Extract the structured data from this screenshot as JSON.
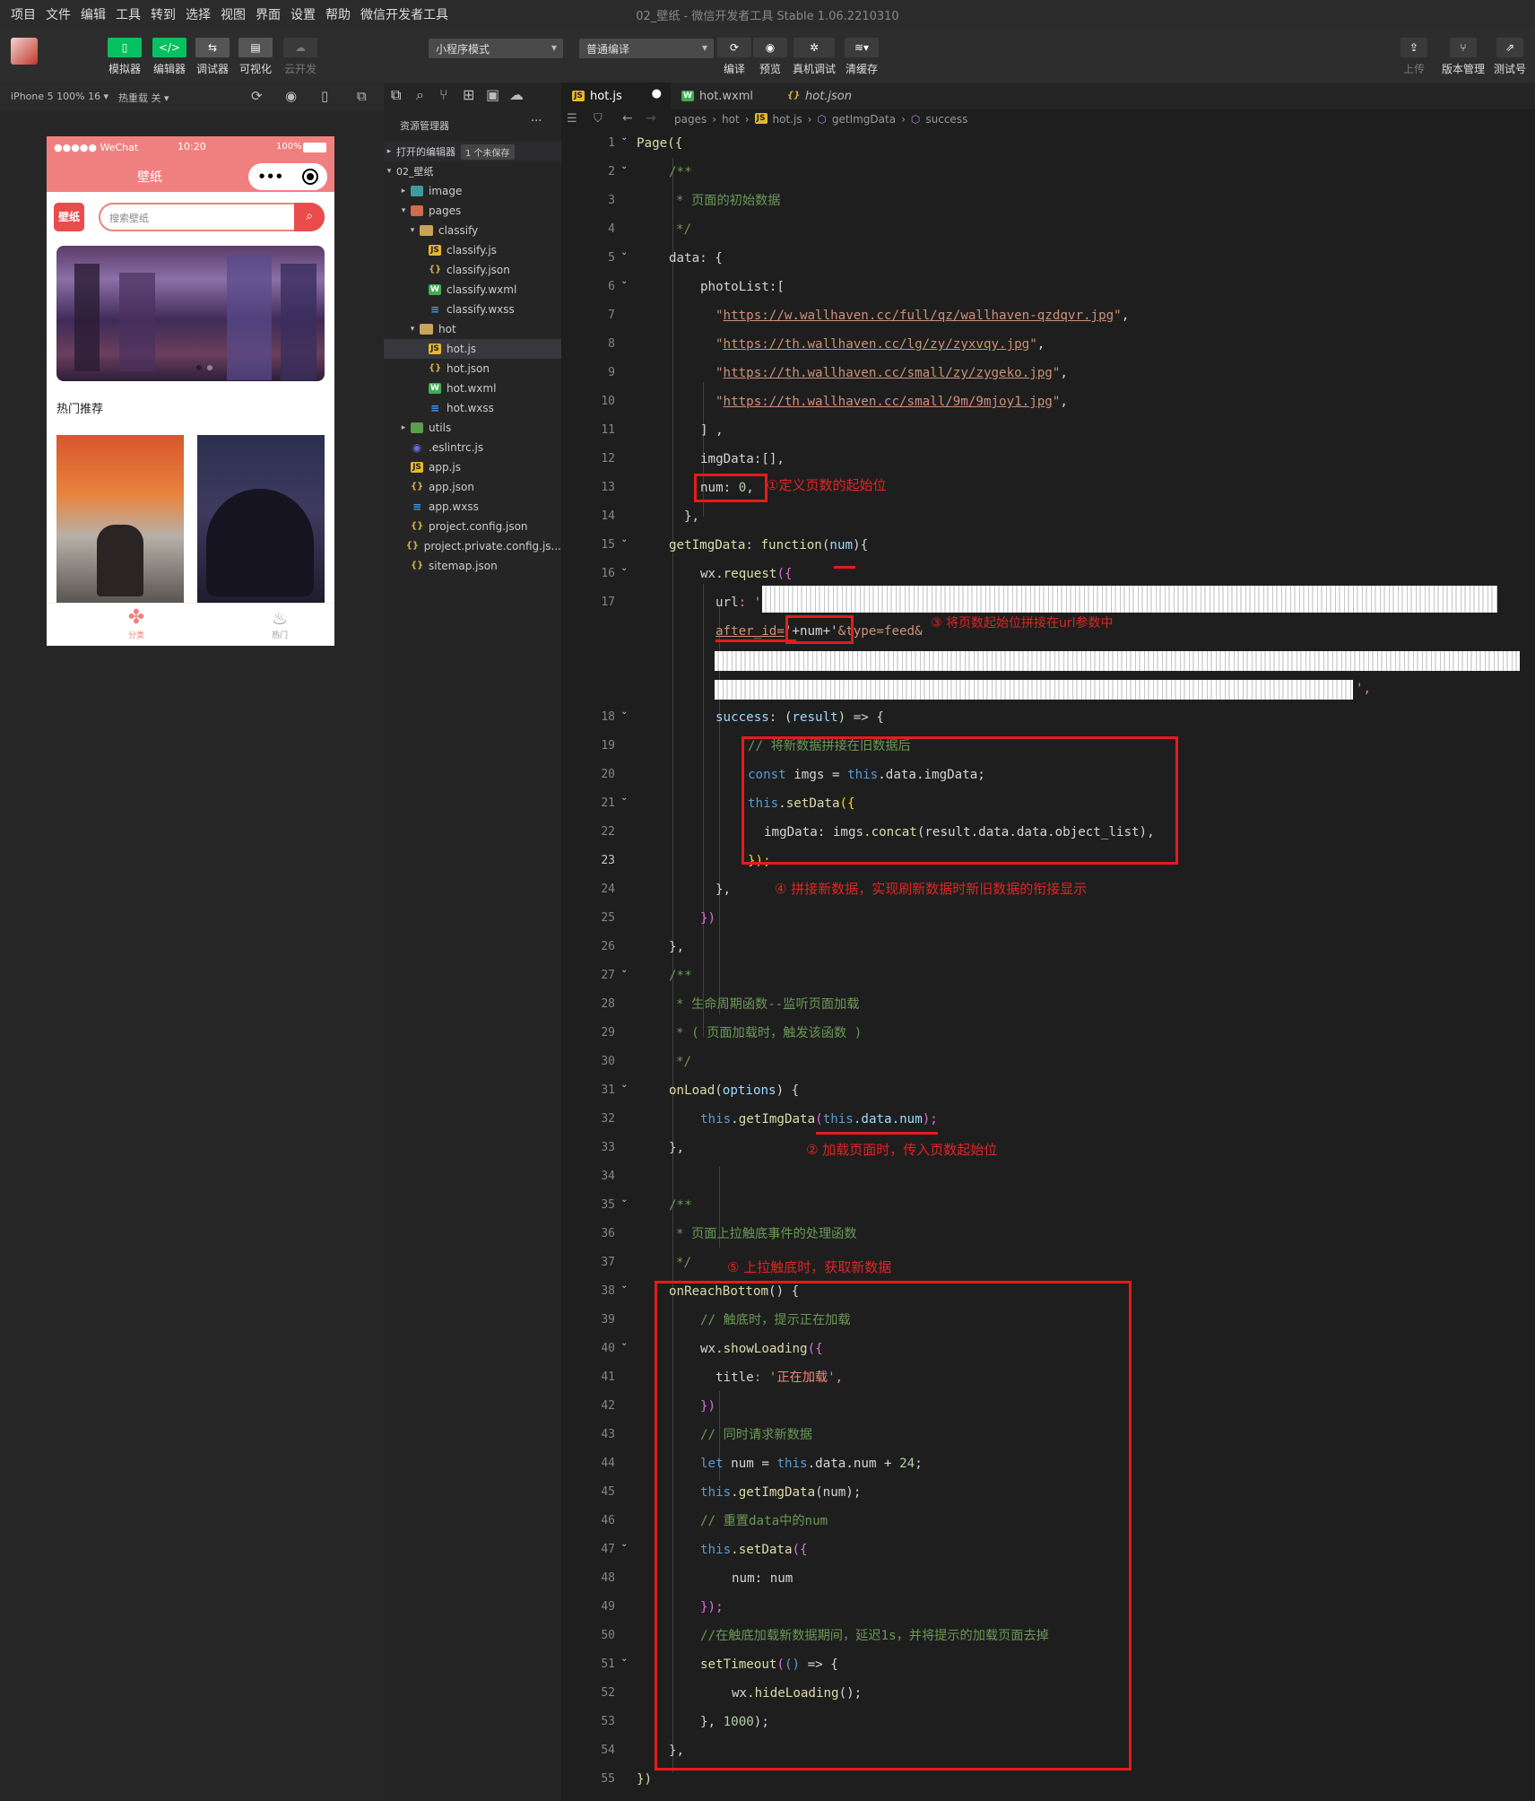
{
  "menubar": {
    "items": [
      "项目",
      "文件",
      "编辑",
      "工具",
      "转到",
      "选择",
      "视图",
      "界面",
      "设置",
      "帮助",
      "微信开发者工具"
    ],
    "window_title": "02_壁纸 - 微信开发者工具 Stable 1.06.2210310"
  },
  "toolbar": {
    "left_buttons": [
      {
        "label": "模拟器",
        "icon": "phone-icon",
        "color": "#07c160"
      },
      {
        "label": "编辑器",
        "icon": "code-icon",
        "color": "#07c160"
      },
      {
        "label": "调试器",
        "icon": "debug-icon",
        "color": "#555555"
      },
      {
        "label": "可视化",
        "icon": "layout-icon",
        "color": "#555555"
      },
      {
        "label": "云开发",
        "icon": "cloud-icon",
        "color": "#3a3a3a"
      }
    ],
    "mode_select": "小程序模式",
    "compile_select": "普通编译",
    "mid_buttons": [
      {
        "label": "编译",
        "icon": "refresh-icon"
      },
      {
        "label": "预览",
        "icon": "eye-icon"
      },
      {
        "label": "真机调试",
        "icon": "bug-icon"
      },
      {
        "label": "清缓存",
        "icon": "layers-icon"
      }
    ],
    "right_buttons": [
      {
        "label": "上传",
        "icon": "upload-icon"
      },
      {
        "label": "版本管理",
        "icon": "branch-icon"
      },
      {
        "label": "测试号",
        "icon": "external-icon"
      }
    ]
  },
  "simulator": {
    "device": "iPhone 5 100% 16 ▾",
    "hot_reload": "热重载 关 ▾",
    "status_left": "●●●●● WeChat",
    "status_time": "10:20",
    "status_right": "100%",
    "nav_title": "壁纸",
    "logo_text": "壁纸",
    "search_placeholder": "搜索壁纸",
    "section_title": "热门推荐",
    "tabbar": [
      {
        "label": "分类",
        "icon": "clover-icon"
      },
      {
        "label": "热门",
        "icon": "fire-icon"
      }
    ]
  },
  "explorer": {
    "title": "资源管理器",
    "more": "···",
    "open_editors": "打开的编辑器",
    "unsaved_badge": "1 个未保存",
    "project": "02_壁纸",
    "tree": [
      {
        "label": "image",
        "type": "fimg",
        "depth": 1,
        "arrow": "▸"
      },
      {
        "label": "pages",
        "type": "fpages",
        "depth": 1,
        "arrow": "▾"
      },
      {
        "label": "classify",
        "type": "folder",
        "depth": 2,
        "arrow": "▾"
      },
      {
        "label": "classify.js",
        "type": "js",
        "depth": 3,
        "arrow": ""
      },
      {
        "label": "classify.json",
        "type": "json",
        "depth": 3,
        "arrow": ""
      },
      {
        "label": "classify.wxml",
        "type": "wxml",
        "depth": 3,
        "arrow": ""
      },
      {
        "label": "classify.wxss",
        "type": "wxss",
        "depth": 3,
        "arrow": ""
      },
      {
        "label": "hot",
        "type": "folder",
        "depth": 2,
        "arrow": "▾"
      },
      {
        "label": "hot.js",
        "type": "js",
        "depth": 3,
        "arrow": "",
        "selected": true
      },
      {
        "label": "hot.json",
        "type": "json",
        "depth": 3,
        "arrow": ""
      },
      {
        "label": "hot.wxml",
        "type": "wxml",
        "depth": 3,
        "arrow": ""
      },
      {
        "label": "hot.wxss",
        "type": "wxss",
        "depth": 3,
        "arrow": ""
      },
      {
        "label": "utils",
        "type": "futils",
        "depth": 1,
        "arrow": "▸"
      },
      {
        "label": ".eslintrc.js",
        "type": "eslint",
        "depth": 1,
        "arrow": ""
      },
      {
        "label": "app.js",
        "type": "js",
        "depth": 1,
        "arrow": ""
      },
      {
        "label": "app.json",
        "type": "json",
        "depth": 1,
        "arrow": ""
      },
      {
        "label": "app.wxss",
        "type": "wxss",
        "depth": 1,
        "arrow": ""
      },
      {
        "label": "project.config.json",
        "type": "json",
        "depth": 1,
        "arrow": ""
      },
      {
        "label": "project.private.config.js...",
        "type": "json",
        "depth": 1,
        "arrow": ""
      },
      {
        "label": "sitemap.json",
        "type": "json",
        "depth": 1,
        "arrow": ""
      }
    ]
  },
  "tabs": [
    {
      "label": "hot.js",
      "icon": "js",
      "active": true,
      "dirty": "●"
    },
    {
      "label": "hot.wxml",
      "icon": "wxml"
    },
    {
      "label": "hot.json",
      "icon": "json",
      "italic": true
    }
  ],
  "breadcrumbs": [
    "pages",
    "hot",
    "hot.js",
    "getImgData",
    "success"
  ],
  "line_numbers": [
    "1",
    "2",
    "3",
    "4",
    "5",
    "6",
    "7",
    "8",
    "9",
    "10",
    "11",
    "12",
    "13",
    "14",
    "15",
    "16",
    "17",
    "18",
    "19",
    "20",
    "21",
    "22",
    "23",
    "24",
    "25",
    "26",
    "27",
    "28",
    "29",
    "30",
    "31",
    "32",
    "33",
    "34",
    "35",
    "36",
    "37",
    "38",
    "39",
    "40",
    "41",
    "42",
    "43",
    "44",
    "45",
    "46",
    "47",
    "48",
    "49",
    "50",
    "51",
    "52",
    "53",
    "54",
    "55"
  ],
  "code": {
    "l1": "Page({",
    "l2": "/**",
    "l3": "* 页面的初始数据",
    "l4": "*/",
    "l5a": "data",
    "l5b": ": {",
    "l6": "photoList:[",
    "url1": "https://w.wallhaven.cc/full/qz/wallhaven-qzdqvr.jpg",
    "url2": "https://th.wallhaven.cc/lg/zy/zyxvqy.jpg",
    "url3": "https://th.wallhaven.cc/small/zy/zygeko.jpg",
    "url4": "https://th.wallhaven.cc/small/9m/9mjoy1.jpg",
    "l11": "] ,",
    "l12": "imgData:[],",
    "l13a": "num",
    "l13b": ": ",
    "l13c": "0",
    "l13d": ",",
    "l14": "},",
    "l15a": "getImgData",
    "l15b": ": ",
    "l15c": "function",
    "l15d": "(",
    "l15e": "num",
    "l15f": "){",
    "l16a": "wx",
    "l16b": ".request",
    "l16c": "({",
    "l17a": "url",
    "l17b": ": '",
    "l17c1": "after_id=",
    "l17c2": "'+num+'",
    "l17c3": "&type=feed&",
    "l17d": "',",
    "l18a": "success",
    "l18b": ": (",
    "l18c": "result",
    "l18d": ") => {",
    "l19": "// 将新数据拼接在旧数据后",
    "l20a": "const",
    "l20b": " imgs ",
    "l20c": "= ",
    "l20d": "this",
    "l20e": ".data.imgData;",
    "l21a": "this",
    "l21b": ".setData",
    "l21c": "({",
    "l22a": "imgData: imgs.",
    "l22b": "concat",
    "l22c": "(result.data.data.object_list),",
    "l23": "});",
    "l24": "},",
    "l25": "})",
    "l26": "},",
    "l27": "/**",
    "l28": "* 生命周期函数--监听页面加载",
    "l29": "* ( 页面加载时，触发该函数 )",
    "l30": "*/",
    "l31a": "onLoad",
    "l31b": "(",
    "l31c": "options",
    "l31d": ") {",
    "l32a": "this",
    "l32b": ".getImgData",
    "l32c": "(",
    "l32d": "this",
    "l32e": ".data.num",
    "l32f": ");",
    "l33": "},",
    "l35": "/**",
    "l36": "* 页面上拉触底事件的处理函数",
    "l37": "*/",
    "l38a": "onReachBottom",
    "l38b": "() {",
    "l39": "// 触底时，提示正在加载",
    "l40a": "wx",
    "l40b": ".showLoading",
    "l40c": "({",
    "l41a": "title",
    "l41b": ": '",
    "l41c": "正在加载",
    "l41d": "',",
    "l42": "})",
    "l43": "// 同时请求新数据",
    "l44a": "let",
    "l44b": " num ",
    "l44c": "= ",
    "l44d": "this",
    "l44e": ".data.num ",
    "l44f": "+ ",
    "l44g": "24",
    "l44h": ";",
    "l45a": "this",
    "l45b": ".getImgData",
    "l45c": "(num);",
    "l46": "// 重置data中的num",
    "l47a": "this",
    "l47b": ".setData",
    "l47c": "({",
    "l48": "num: num",
    "l49": "});",
    "l50": "//在触底加载新数据期间，延迟1s，并将提示的加载页面去掉",
    "l51a": "setTimeout",
    "l51b": "(",
    "l51c": "()",
    "l51d": " => {",
    "l52a": "wx",
    "l52b": ".hideLoading",
    "l52c": "();",
    "l53a": "}, ",
    "l53b": "1000",
    "l53c": ");",
    "l54": "},",
    "l55": "})"
  },
  "annotations": {
    "a1": "①定义页数的起始位",
    "a2": "② 加载页面时，传入页数起始位",
    "a3": "③ 将页数起始位拼接在url参数中",
    "a4": "④ 拼接新数据，实现刷新数据时新旧数据的衔接显示",
    "a5": "⑤ 上拉触底时，获取新数据"
  },
  "colors": {
    "accent_red": "#e51b1b",
    "wechat_green": "#07c160",
    "phone_nav": "#f08080"
  }
}
